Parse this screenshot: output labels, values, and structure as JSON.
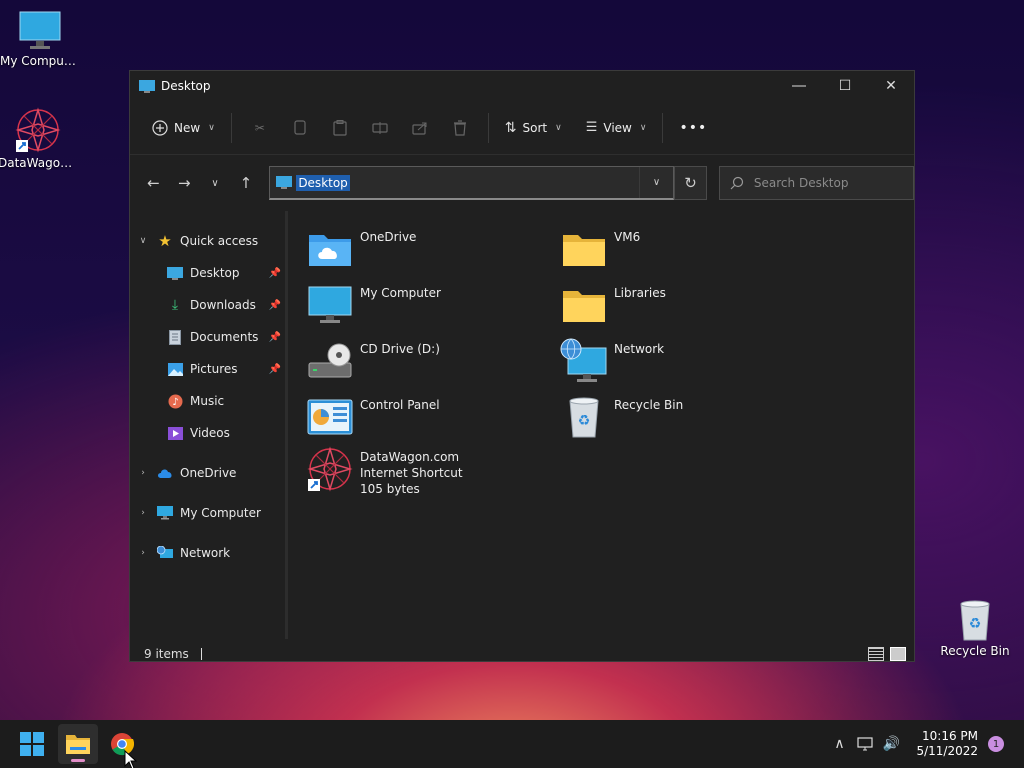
{
  "desktop": {
    "icons": [
      {
        "label": "My Computer"
      },
      {
        "label": "DataWagon..."
      },
      {
        "label": "Recycle Bin"
      }
    ]
  },
  "window": {
    "title": "Desktop",
    "toolbar": {
      "new_label": "New",
      "sort_label": "Sort",
      "view_label": "View",
      "more_label": "•••"
    },
    "address": {
      "path": "Desktop",
      "search_placeholder": "Search Desktop"
    },
    "nav": {
      "quick_access": "Quick access",
      "items": [
        {
          "label": "Desktop"
        },
        {
          "label": "Downloads"
        },
        {
          "label": "Documents"
        },
        {
          "label": "Pictures"
        },
        {
          "label": "Music"
        },
        {
          "label": "Videos"
        }
      ],
      "onedrive": "OneDrive",
      "my_computer": "My Computer",
      "network": "Network"
    },
    "content": {
      "items": [
        {
          "name": "OneDrive"
        },
        {
          "name": "VM6"
        },
        {
          "name": "My Computer"
        },
        {
          "name": "Libraries"
        },
        {
          "name": "CD Drive (D:)"
        },
        {
          "name": "Network"
        },
        {
          "name": "Control Panel"
        },
        {
          "name": "Recycle Bin"
        },
        {
          "name": "DataWagon.com",
          "type": "Internet Shortcut",
          "size": "105 bytes"
        }
      ]
    },
    "status": {
      "count": "9 items"
    }
  },
  "taskbar": {
    "time": "10:16 PM",
    "date": "5/11/2022",
    "notifications": "1"
  }
}
